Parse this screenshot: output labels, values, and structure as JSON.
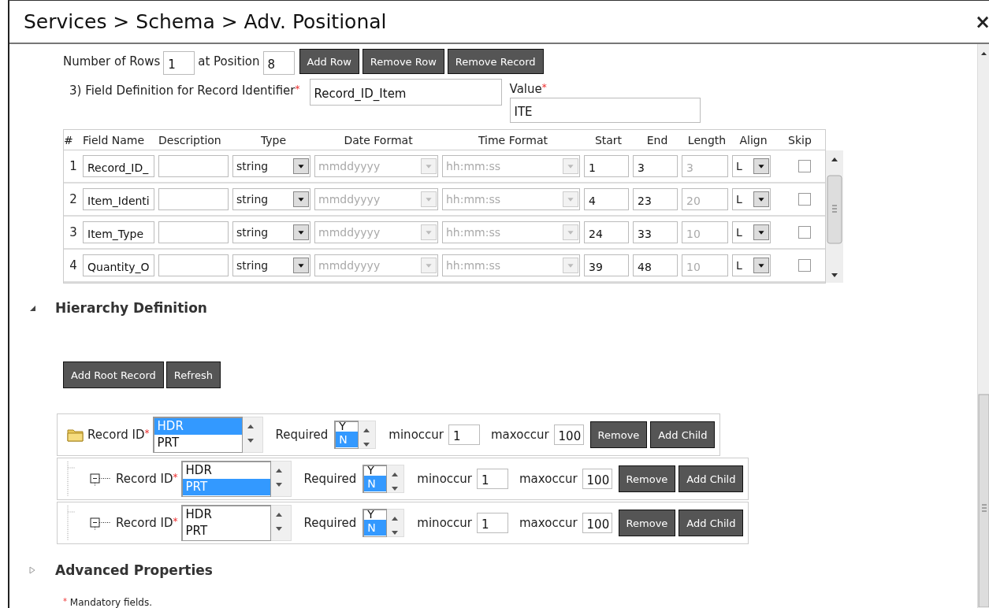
{
  "window": {
    "title": "Services > Schema > Adv. Positional",
    "close": "×"
  },
  "row_controls": {
    "rows_label": "Number of Rows",
    "rows_value": "1",
    "position_label": "at Position",
    "position_value": "8",
    "buttons": [
      "Add Row",
      "Remove Row",
      "Remove Record"
    ]
  },
  "record_identifier": {
    "label": "3) Field Definition for Record Identifier",
    "required_mark": "*",
    "value": "Record_ID_Item",
    "value_label": "Value",
    "value_required_mark": "*",
    "value_value": "ITE"
  },
  "fields": {
    "columns": [
      "#",
      "Field Name",
      "Description",
      "Type",
      "Date Format",
      "Time Format",
      "Start",
      "End",
      "Length",
      "Align",
      "Skip"
    ],
    "rows": [
      {
        "number": "1",
        "field_name": "Record_ID_",
        "description": "",
        "type": "string",
        "date_format": "mmddyyyy",
        "time_format": "hh:mm:ss",
        "formats_disabled": true,
        "start": "1",
        "end": "3",
        "length": "3",
        "length_disabled": true,
        "align": "L",
        "skip": false
      },
      {
        "number": "2",
        "field_name": "Item_Identi",
        "description": "",
        "type": "string",
        "date_format": "mmddyyyy",
        "time_format": "hh:mm:ss",
        "formats_disabled": true,
        "start": "4",
        "end": "23",
        "length": "20",
        "length_disabled": true,
        "align": "L",
        "skip": false
      },
      {
        "number": "3",
        "field_name": "Item_Type",
        "description": "",
        "type": "string",
        "date_format": "mmddyyyy",
        "time_format": "hh:mm:ss",
        "formats_disabled": true,
        "start": "24",
        "end": "33",
        "length": "10",
        "length_disabled": true,
        "align": "L",
        "skip": false
      },
      {
        "number": "4",
        "field_name": "Quantity_O",
        "description": "",
        "type": "string",
        "date_format": "mmddyyyy",
        "time_format": "hh:mm:ss",
        "formats_disabled": true,
        "start": "39",
        "end": "48",
        "length": "10",
        "length_disabled": true,
        "align": "L",
        "skip": false
      }
    ]
  },
  "hierarchy": {
    "title": "Hierarchy Definition",
    "expanded": true,
    "buttons": [
      "Add Root Record",
      "Refresh"
    ],
    "records": [
      {
        "kind": "root",
        "label": "Record ID",
        "required_mark": "*",
        "options": [
          {
            "label": "HDR",
            "selected": true
          },
          {
            "label": "PRT",
            "selected": false
          }
        ],
        "required_label": "Required",
        "required_options": [
          {
            "label": "Y",
            "selected": false
          },
          {
            "label": "N",
            "selected": true
          }
        ],
        "min_label": "minoccur",
        "min_value": "1",
        "max_label": "maxoccur",
        "max_value": "100",
        "buttons": [
          "Remove",
          "Add Child"
        ],
        "children": [
          {
            "kind": "child",
            "label": "Record ID",
            "required_mark": "*",
            "options": [
              {
                "label": "HDR",
                "selected": false
              },
              {
                "label": "PRT",
                "selected": true
              }
            ],
            "required_label": "Required",
            "required_options": [
              {
                "label": "Y",
                "selected": false
              },
              {
                "label": "N",
                "selected": true
              }
            ],
            "min_label": "minoccur",
            "min_value": "1",
            "max_label": "maxoccur",
            "max_value": "100",
            "buttons": [
              "Remove",
              "Add Child"
            ]
          },
          {
            "kind": "child",
            "label": "Record ID",
            "required_mark": "*",
            "options": [
              {
                "label": "HDR",
                "selected": false
              },
              {
                "label": "PRT",
                "selected": false
              }
            ],
            "required_label": "Required",
            "required_options": [
              {
                "label": "Y",
                "selected": false
              },
              {
                "label": "N",
                "selected": true
              }
            ],
            "min_label": "minoccur",
            "min_value": "1",
            "max_label": "maxoccur",
            "max_value": "100",
            "buttons": [
              "Remove",
              "Add Child"
            ]
          }
        ]
      }
    ]
  },
  "advanced": {
    "title": "Advanced Properties",
    "expanded": false
  },
  "footnote": {
    "mark": "*",
    "text": "Mandatory fields."
  }
}
